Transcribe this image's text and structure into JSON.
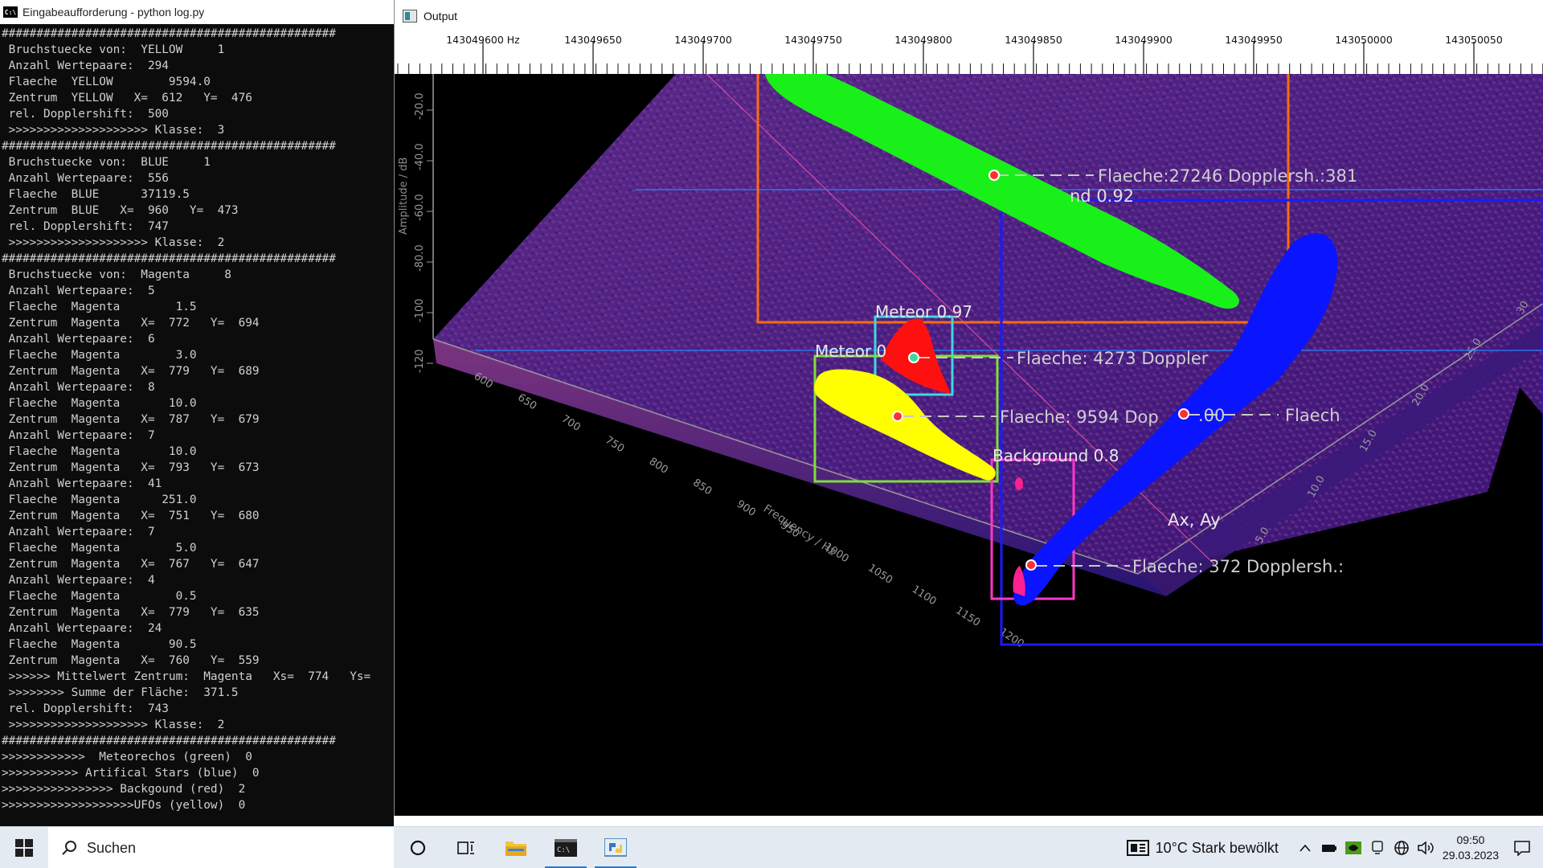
{
  "console": {
    "title": "Eingabeaufforderung - python  log.py",
    "lines": [
      "################################################",
      " Bruchstuecke von:  YELLOW     1",
      " Anzahl Wertepaare:  294",
      " Flaeche  YELLOW        9594.0",
      " Zentrum  YELLOW   X=  612   Y=  476",
      " rel. Dopplershift:  500",
      " >>>>>>>>>>>>>>>>>>>> Klasse:  3",
      "################################################",
      " Bruchstuecke von:  BLUE     1",
      " Anzahl Wertepaare:  556",
      " Flaeche  BLUE      37119.5",
      " Zentrum  BLUE   X=  960   Y=  473",
      " rel. Dopplershift:  747",
      " >>>>>>>>>>>>>>>>>>>> Klasse:  2",
      "################################################",
      " Bruchstuecke von:  Magenta     8",
      " Anzahl Wertepaare:  5",
      " Flaeche  Magenta        1.5",
      " Zentrum  Magenta   X=  772   Y=  694",
      " Anzahl Wertepaare:  6",
      " Flaeche  Magenta        3.0",
      " Zentrum  Magenta   X=  779   Y=  689",
      " Anzahl Wertepaare:  8",
      " Flaeche  Magenta       10.0",
      " Zentrum  Magenta   X=  787   Y=  679",
      " Anzahl Wertepaare:  7",
      " Flaeche  Magenta       10.0",
      " Zentrum  Magenta   X=  793   Y=  673",
      " Anzahl Wertepaare:  41",
      " Flaeche  Magenta      251.0",
      " Zentrum  Magenta   X=  751   Y=  680",
      " Anzahl Wertepaare:  7",
      " Flaeche  Magenta        5.0",
      " Zentrum  Magenta   X=  767   Y=  647",
      " Anzahl Wertepaare:  4",
      " Flaeche  Magenta        0.5",
      " Zentrum  Magenta   X=  779   Y=  635",
      " Anzahl Wertepaare:  24",
      " Flaeche  Magenta       90.5",
      " Zentrum  Magenta   X=  760   Y=  559",
      " >>>>>> Mittelwert Zentrum:  Magenta   Xs=  774   Ys=",
      " >>>>>>>> Summe der Fläche:  371.5",
      " rel. Dopplershift:  743",
      " >>>>>>>>>>>>>>>>>>>> Klasse:  2",
      "################################################",
      ">>>>>>>>>>>>  Meteorechos (green)  0",
      ">>>>>>>>>>> Artifical Stars (blue)  0",
      ">>>>>>>>>>>>>>>> Backgound (red)  2",
      ">>>>>>>>>>>>>>>>>>>UFOs (yellow)  0"
    ]
  },
  "output": {
    "title": "Output",
    "ruler_labels": [
      "143049600 Hz",
      "143049650",
      "143049700",
      "143049750",
      "143049800",
      "143049850",
      "143049900",
      "143049950",
      "143050000",
      "143050050"
    ],
    "amplitude_axis": {
      "label": "Amplitude / dB",
      "ticks": [
        "-20.0",
        "-40.0",
        "-60.0",
        "-80.0",
        "-100",
        "-120"
      ]
    },
    "frequency_axis": {
      "label": "Frequency / Hz",
      "ticks": [
        "600",
        "650",
        "700",
        "750",
        "800",
        "850",
        "900",
        "950",
        "1000",
        "1050",
        "1100",
        "1150",
        "1200"
      ]
    },
    "time_axis": {
      "ticks": [
        "5.0",
        "10.0",
        "15.0",
        "20.0",
        "25.0",
        "30"
      ]
    },
    "ax_ay_label": "Ax, Ay",
    "detections": {
      "meteor_red": "Meteor 0.97",
      "meteor_yellow": "Meteor 0",
      "background_top": "nd 0.92",
      "background_magenta": "Background 0.8"
    },
    "annotations": {
      "green": "Flaeche:27246 Dopplersh.:381",
      "red": "Flaeche: 4273 Doppler",
      "yellow": "Flaeche: 9594 Dop",
      "blue_mid": ".00",
      "blue_end": "Flaech",
      "magenta": "Flaeche:   372 Dopplersh.:"
    },
    "colors": {
      "green_blob": "#19f019",
      "blue_blob": "#0a14ff",
      "red_blob": "#ff1010",
      "yellow_blob": "#ffff00",
      "orange_box": "#ff6a10",
      "cyan_box": "#3dd8e0",
      "lime_box": "#7ee03a",
      "magenta_box": "#ff38c8",
      "blue_box": "#1a1aff"
    }
  },
  "taskbar": {
    "search_placeholder": "Suchen",
    "weather": "10°C  Stark bewölkt",
    "time": "09:50",
    "date": "29.03.2023"
  }
}
